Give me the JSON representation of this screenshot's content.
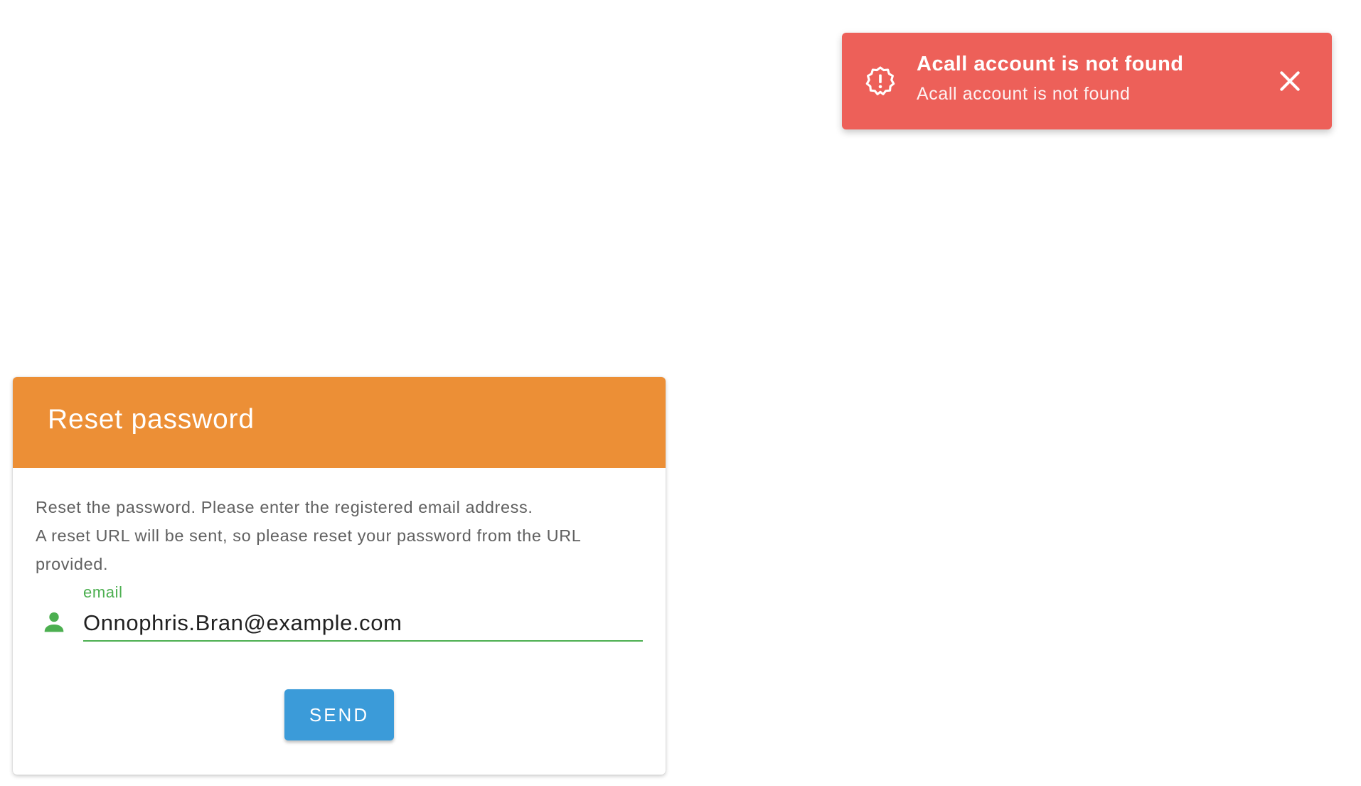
{
  "toast": {
    "title": "Acall account is not found",
    "message": "Acall account is not found",
    "icon": "alert-badge-icon",
    "close_icon": "close-icon",
    "color": "#ed6059"
  },
  "card": {
    "title": "Reset password",
    "header_color": "#ec8f36",
    "description_line1": "Reset the password. Please enter the registered email address.",
    "description_line2": "A reset URL will be sent, so please reset your password from the URL provided.",
    "email": {
      "label": "email",
      "value": "Onnophris.Bran@example.com",
      "icon": "person-icon",
      "accent_color": "#4caf50"
    },
    "send_label": "SEND",
    "send_color": "#3b9bd9"
  }
}
